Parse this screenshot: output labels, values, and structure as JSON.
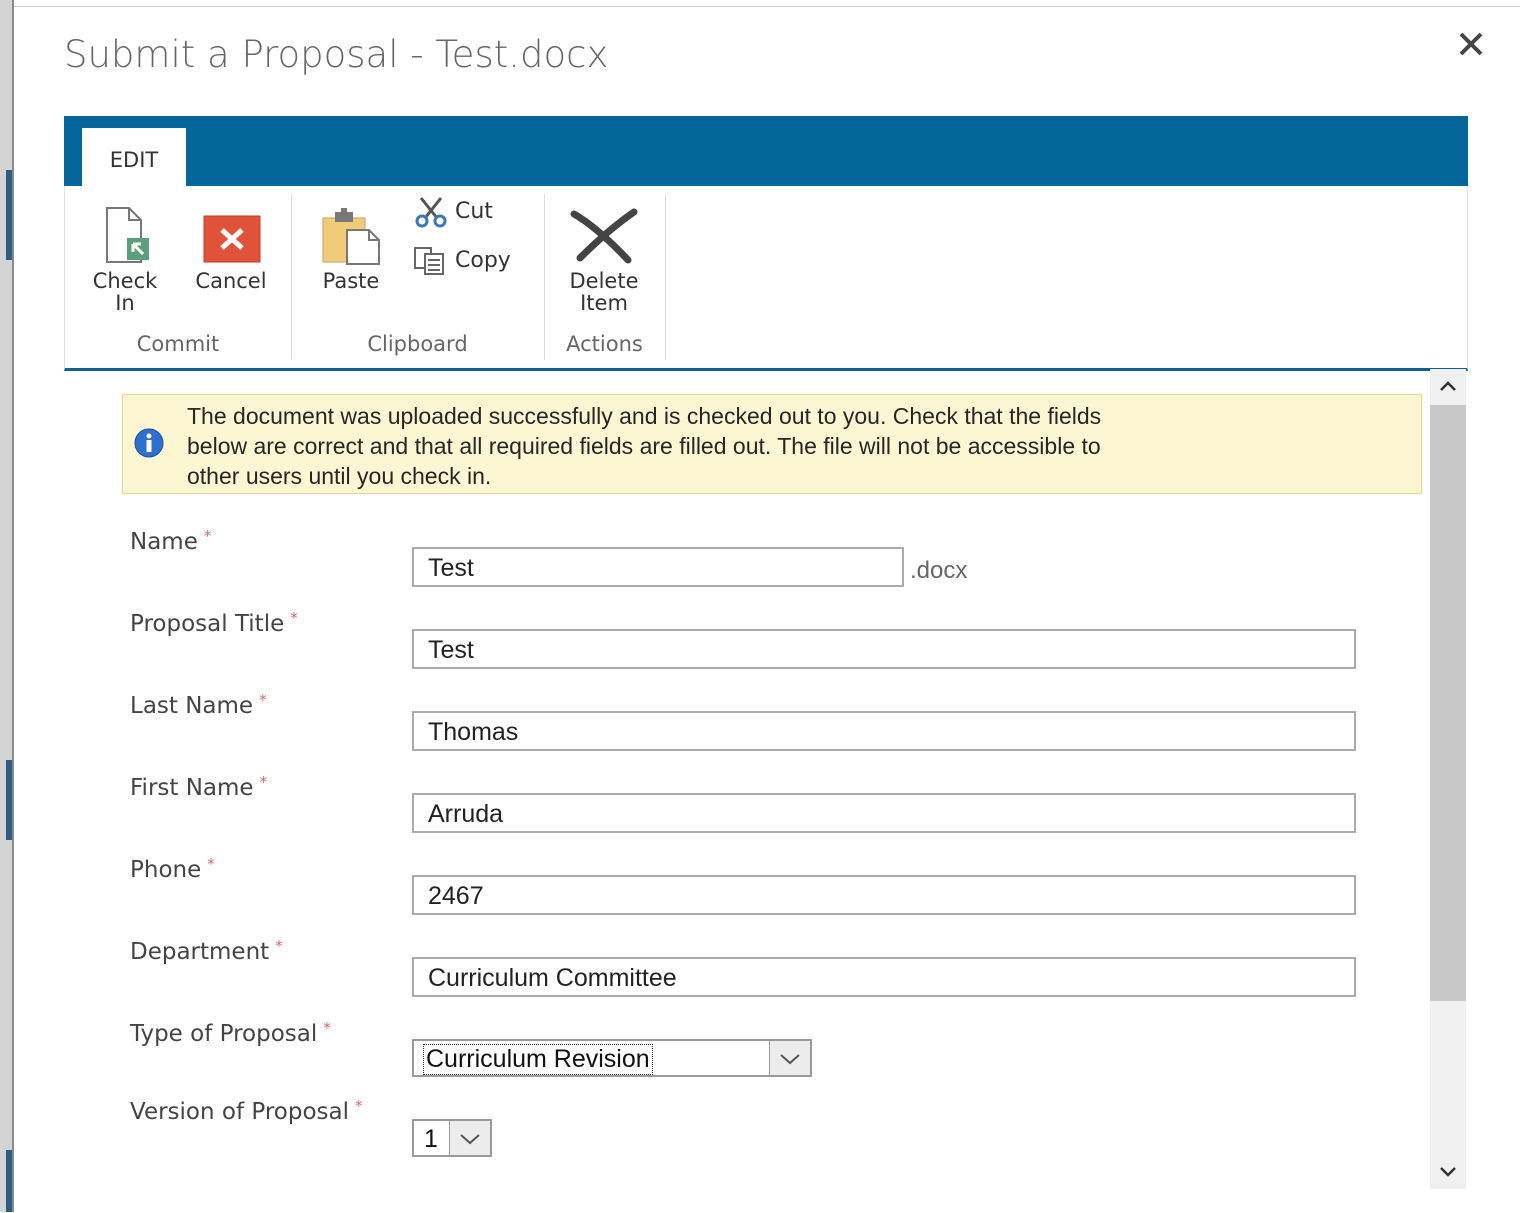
{
  "dialog": {
    "title": "Submit a Proposal - Test.docx"
  },
  "ribbon": {
    "tab_label": "EDIT",
    "accent_color": "#04669b",
    "groups": {
      "commit": {
        "label": "Commit",
        "check_in_line1": "Check",
        "check_in_line2": "In",
        "cancel": "Cancel"
      },
      "clipboard": {
        "label": "Clipboard",
        "paste": "Paste",
        "cut": "Cut",
        "copy": "Copy"
      },
      "actions": {
        "label": "Actions",
        "delete_line1": "Delete",
        "delete_line2": "Item"
      }
    }
  },
  "info": {
    "line1": "The document was uploaded successfully and is checked out to you. Check that the fields",
    "line2": "below are correct and that all required fields are filled out. The file will not be accessible to",
    "line3": "other users until you check in."
  },
  "form": {
    "required_marker": "*",
    "name": {
      "label": "Name",
      "value": "Test",
      "suffix": ".docx"
    },
    "proposal_title": {
      "label": "Proposal Title",
      "value": "Test"
    },
    "last_name": {
      "label": "Last Name",
      "value": "Thomas"
    },
    "first_name": {
      "label": "First Name",
      "value": "Arruda"
    },
    "phone": {
      "label": "Phone",
      "value": "2467"
    },
    "department": {
      "label": "Department",
      "value": "Curriculum Committee"
    },
    "type_of_proposal": {
      "label": "Type of Proposal",
      "value": "Curriculum Revision"
    },
    "version_of_proposal": {
      "label": "Version of Proposal",
      "value": "1"
    }
  },
  "icons": {
    "close": "close-icon",
    "check_in": "check-in-icon",
    "cancel": "cancel-icon",
    "paste": "paste-icon",
    "cut": "scissors-icon",
    "copy": "copy-icon",
    "delete": "delete-icon",
    "info": "info-icon"
  }
}
